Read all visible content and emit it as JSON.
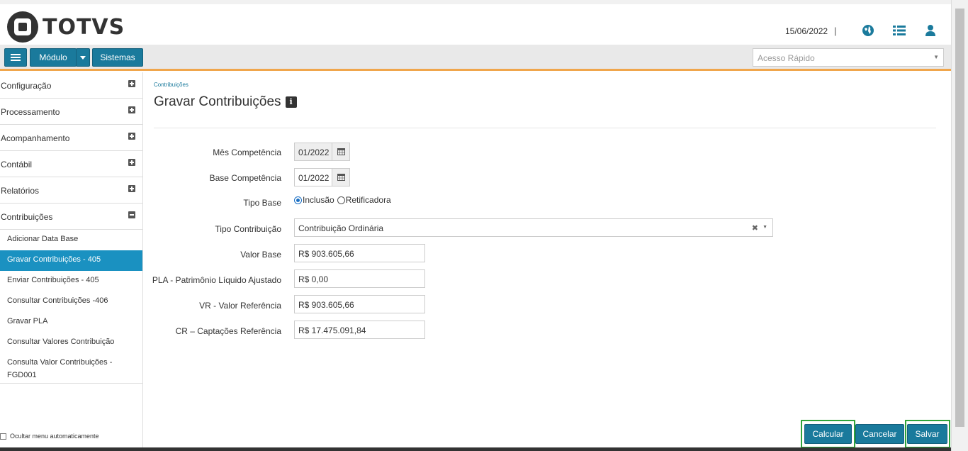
{
  "header": {
    "brand": "TOTVS",
    "date": "15/06/2022",
    "separator": "|",
    "icons": [
      "globe-icon",
      "list-icon",
      "user-icon"
    ]
  },
  "toolbar": {
    "modulo_label": "Módulo",
    "sistemas_label": "Sistemas",
    "quick_access_placeholder": "Acesso Rápido"
  },
  "sidebar": {
    "items": [
      {
        "label": "Configuração"
      },
      {
        "label": "Processamento"
      },
      {
        "label": "Acompanhamento"
      },
      {
        "label": "Contábil"
      },
      {
        "label": "Relatórios"
      },
      {
        "label": "Contribuições"
      }
    ],
    "subitems": [
      {
        "label": "Adicionar Data Base"
      },
      {
        "label": "Gravar Contribuições - 405"
      },
      {
        "label": "Enviar Contribuições - 405"
      },
      {
        "label": "Consultar Contribuições -406"
      },
      {
        "label": "Gravar PLA"
      },
      {
        "label": "Consultar Valores Contribuição"
      },
      {
        "label": "Consulta Valor Contribuições - FGD001"
      }
    ],
    "auto_hide_label": "Ocultar menu automaticamente"
  },
  "main": {
    "breadcrumb": "Contribuições",
    "title": "Gravar Contribuições",
    "info_glyph": "i",
    "form": {
      "mes_competencia_label": "Mês Competência",
      "mes_competencia_value": "01/2022",
      "base_competencia_label": "Base Competência",
      "base_competencia_value": "01/2022",
      "tipo_base_label": "Tipo Base",
      "tipo_base_option_1": "Inclusão",
      "tipo_base_option_2": "Retificadora",
      "tipo_contribuicao_label": "Tipo Contribuição",
      "tipo_contribuicao_value": "Contribuição Ordinária",
      "valor_base_label": "Valor Base",
      "valor_base_value": "R$ 903.605,66",
      "pla_label": "PLA - Patrimônio Líquido Ajustado",
      "pla_value": "R$ 0,00",
      "vr_label": "VR - Valor Referência",
      "vr_value": "R$ 903.605,66",
      "cr_label": "CR – Captações Referência",
      "cr_value": "R$ 17.475.091,84"
    }
  },
  "actions": {
    "calcular": "Calcular",
    "cancelar": "Cancelar",
    "salvar": "Salvar"
  },
  "colors": {
    "primary": "#1a7a9c",
    "active_menu": "#1a91c1",
    "accent_line": "#f0a64c",
    "highlight": "#2fa33a"
  }
}
